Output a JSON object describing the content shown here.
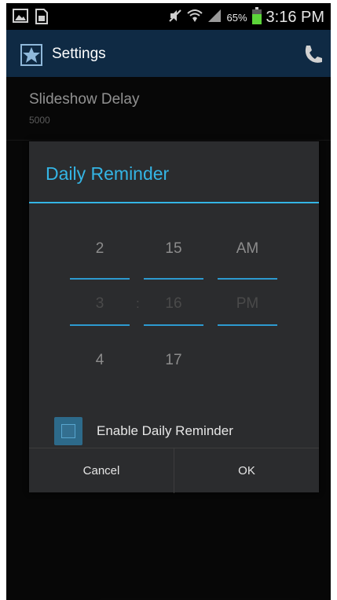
{
  "status_bar": {
    "battery_percent": "65%",
    "time": "3:16 PM",
    "icons_left": [
      "picture-icon",
      "sim-card-icon"
    ],
    "icons_right": [
      "mute-icon",
      "wifi-icon",
      "signal-icon",
      "battery-icon"
    ]
  },
  "action_bar": {
    "title": "Settings",
    "icon": "app-logo-icon",
    "action_icon": "phone-icon"
  },
  "settings": {
    "items": [
      {
        "title": "Slideshow Delay",
        "value": "5000"
      }
    ]
  },
  "dialog": {
    "title": "Daily Reminder",
    "time_picker": {
      "hour": {
        "prev": "2",
        "selected": "3",
        "next": "4"
      },
      "separator": ":",
      "minute": {
        "prev": "15",
        "selected": "16",
        "next": "17"
      },
      "ampm": {
        "prev": "AM",
        "selected": "PM",
        "next": ""
      }
    },
    "checkbox": {
      "label": "Enable Daily Reminder",
      "checked": false
    },
    "buttons": {
      "cancel": "Cancel",
      "ok": "OK"
    }
  },
  "colors": {
    "accent": "#34b5e5",
    "action_bar_bg": "#0f2a44",
    "dialog_bg": "#2b2c2e"
  }
}
